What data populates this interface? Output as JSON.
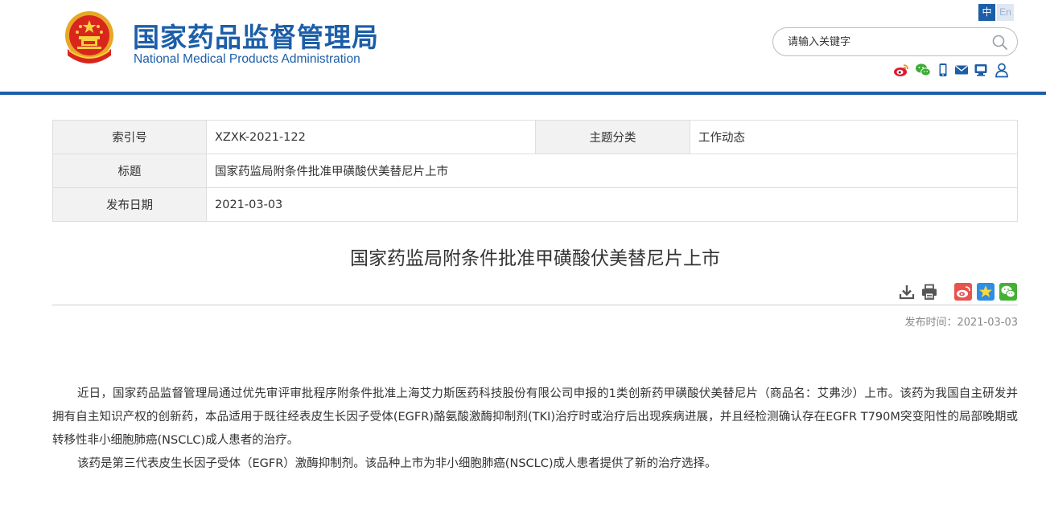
{
  "header": {
    "title_cn": "国家药品监督管理局",
    "title_en": "National Medical Products Administration",
    "lang_cn": "中",
    "lang_en": "En",
    "search_placeholder": "请输入关键字",
    "emblem_icon": "national-emblem-icon",
    "search_icon": "search-icon",
    "social_icons": [
      "weibo-icon",
      "wechat-icon",
      "mobile-icon",
      "mail-icon",
      "message-icon",
      "user-icon"
    ],
    "brand_color": "#1c5ea8"
  },
  "meta": {
    "index_label": "索引号",
    "index_value": "XZXK-2021-122",
    "category_label": "主题分类",
    "category_value": "工作动态",
    "title_label": "标题",
    "title_value": "国家药监局附条件批准甲磺酸伏美替尼片上市",
    "date_label": "发布日期",
    "date_value": "2021-03-03"
  },
  "article": {
    "title": "国家药监局附条件批准甲磺酸伏美替尼片上市",
    "publish_time": "发布时间：2021-03-03",
    "tool_icons": [
      "download-icon",
      "print-icon",
      "weibo-share-icon",
      "qzone-share-icon",
      "wechat-share-icon"
    ],
    "paragraphs": [
      "近日，国家药品监督管理局通过优先审评审批程序附条件批准上海艾力斯医药科技股份有限公司申报的1类创新药甲磺酸伏美替尼片（商品名：艾弗沙）上市。该药为我国自主研发并拥有自主知识产权的创新药，本品适用于既往经表皮生长因子受体(EGFR)酪氨酸激酶抑制剂(TKI)治疗时或治疗后出现疾病进展，并且经检测确认存在EGFR T790M突变阳性的局部晚期或转移性非小细胞肺癌(NSCLC)成人患者的治疗。",
      "该药是第三代表皮生长因子受体（EGFR）激酶抑制剂。该品种上市为非小细胞肺癌(NSCLC)成人患者提供了新的治疗选择。"
    ]
  }
}
